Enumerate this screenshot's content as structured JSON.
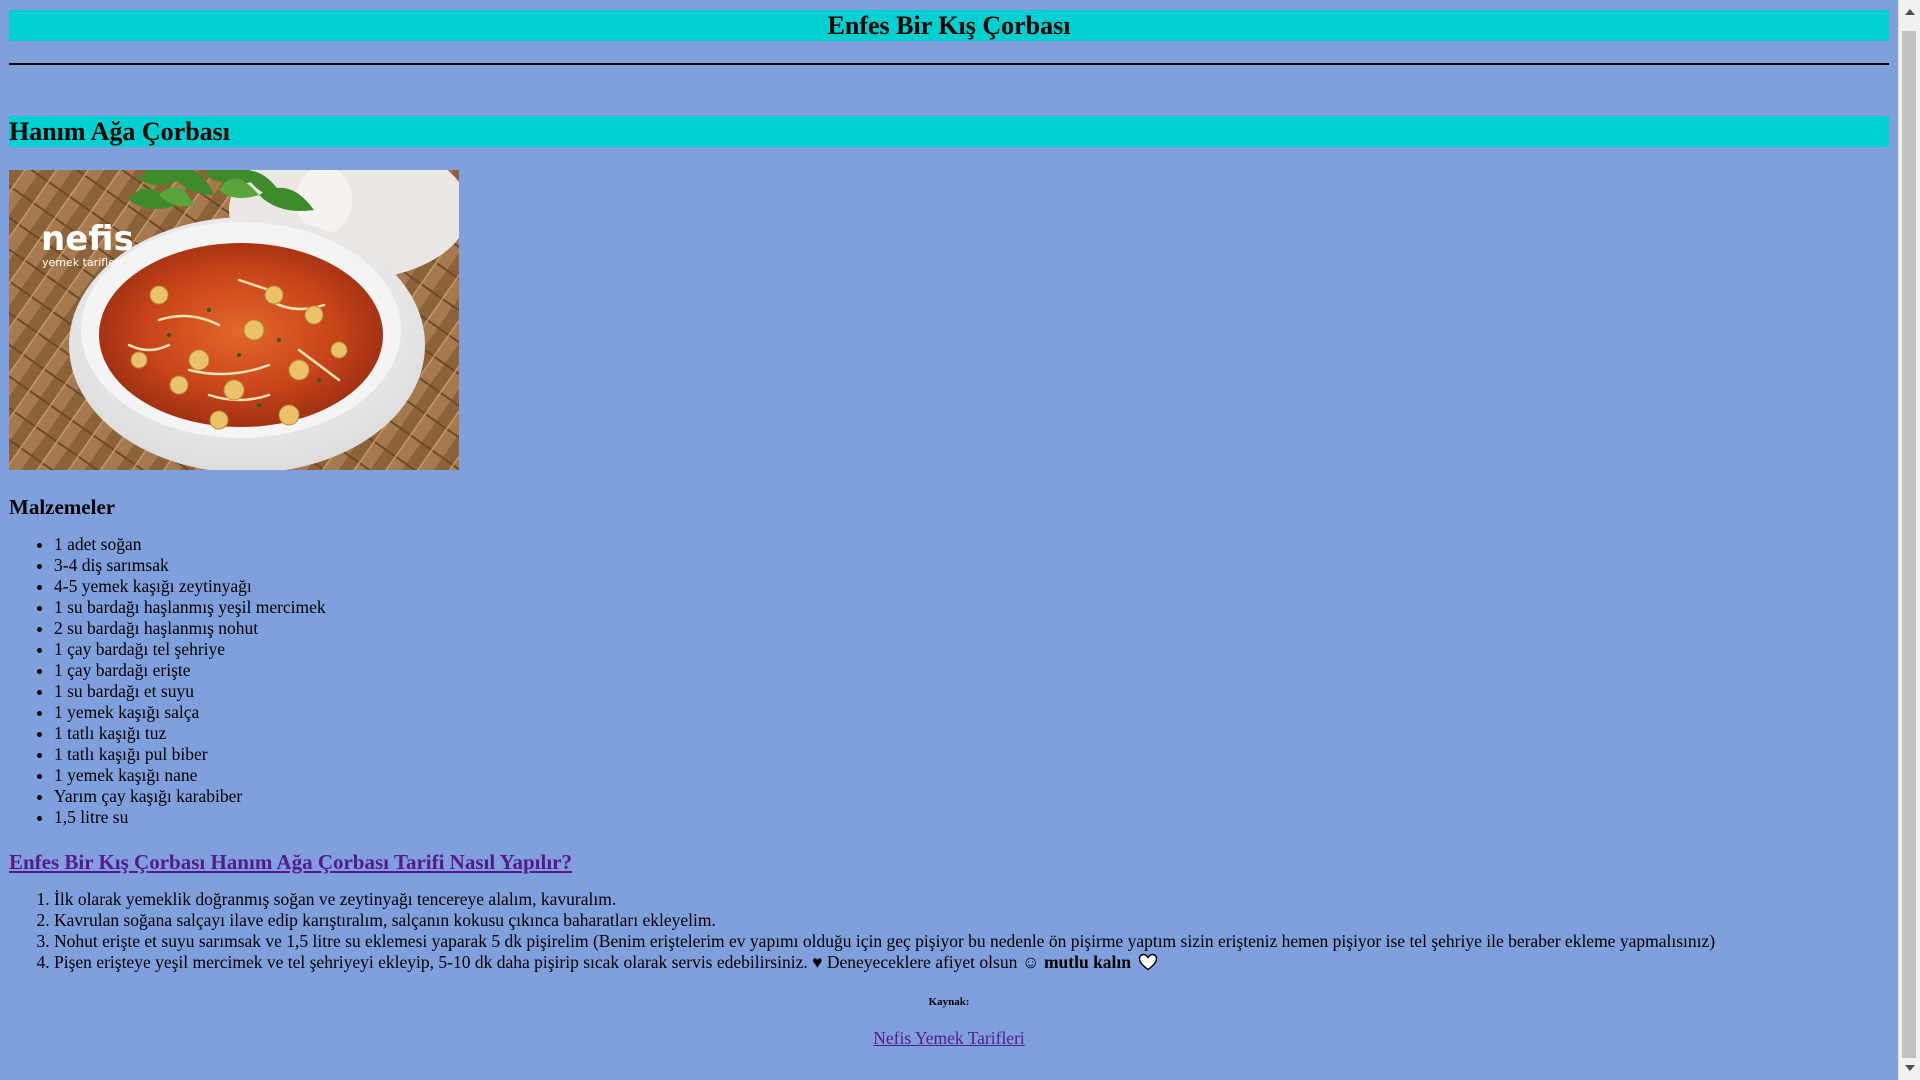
{
  "page": {
    "title": "Enfes Bir Kış Çorbası",
    "section_title": "Hanım Ağa Çorbası",
    "image_icon": "soup-photo",
    "image_watermark": "nefis yemek tarifleri",
    "ingredients_heading": "Malzemeler",
    "ingredients": [
      "1 adet soğan",
      "3-4 diş sarımsak",
      "4-5 yemek kaşığı zeytinyağı",
      "1 su bardağı haşlanmış yeşil mercimek",
      "2 su bardağı haşlanmış nohut",
      "1 çay bardağı tel şehriye",
      "1 çay bardağı erişte",
      "1 su bardağı et suyu",
      "1 yemek kaşığı salça",
      "1 tatlı kaşığı tuz",
      "1 tatlı kaşığı pul biber",
      "1 yemek kaşığı nane",
      "Yarım çay kaşığı karabiber",
      "1,5 litre su"
    ],
    "recipe_link": "Enfes Bir Kış Çorbası Hanım Ağa Çorbası Tarifi Nasıl Yapılır?",
    "steps": [
      "İlk olarak yemeklik doğranmış soğan ve zeytinyağı tencereye alalım, kavuralım.",
      "Kavrulan soğana salçayı ilave edip karıştıralım, salçanın kokusu çıkınca baharatları ekleyelim.",
      "Nohut erişte et suyu sarımsak ve 1,5 litre su eklemesi yaparak 5 dk pişirelim (Benim eriştelerim ev yapımı olduğu için geç pişiyor bu nedenle ön pişirme yaptım sizin erişteniz hemen pişiyor ise tel şehriye ile beraber ekleme yapmalısınız)"
    ],
    "step4_text": "Pişen erişteye yeşil mercimek ve tel şehriyeyi ekleyip, 5-10 dk daha pişirip sıcak olarak servis edebilirsiniz. ♥ Deneyeceklere afiyet olsun ☺",
    "step4_bold": "mutlu kalın",
    "step4_icon": "heart-outline-icon",
    "source_label": "Kaynak:",
    "source_link": "Nefis Yemek Tarifleri"
  },
  "colors": {
    "background": "#7fa0dd",
    "banner": "#00d0d0",
    "link_visited": "#551a8b"
  }
}
